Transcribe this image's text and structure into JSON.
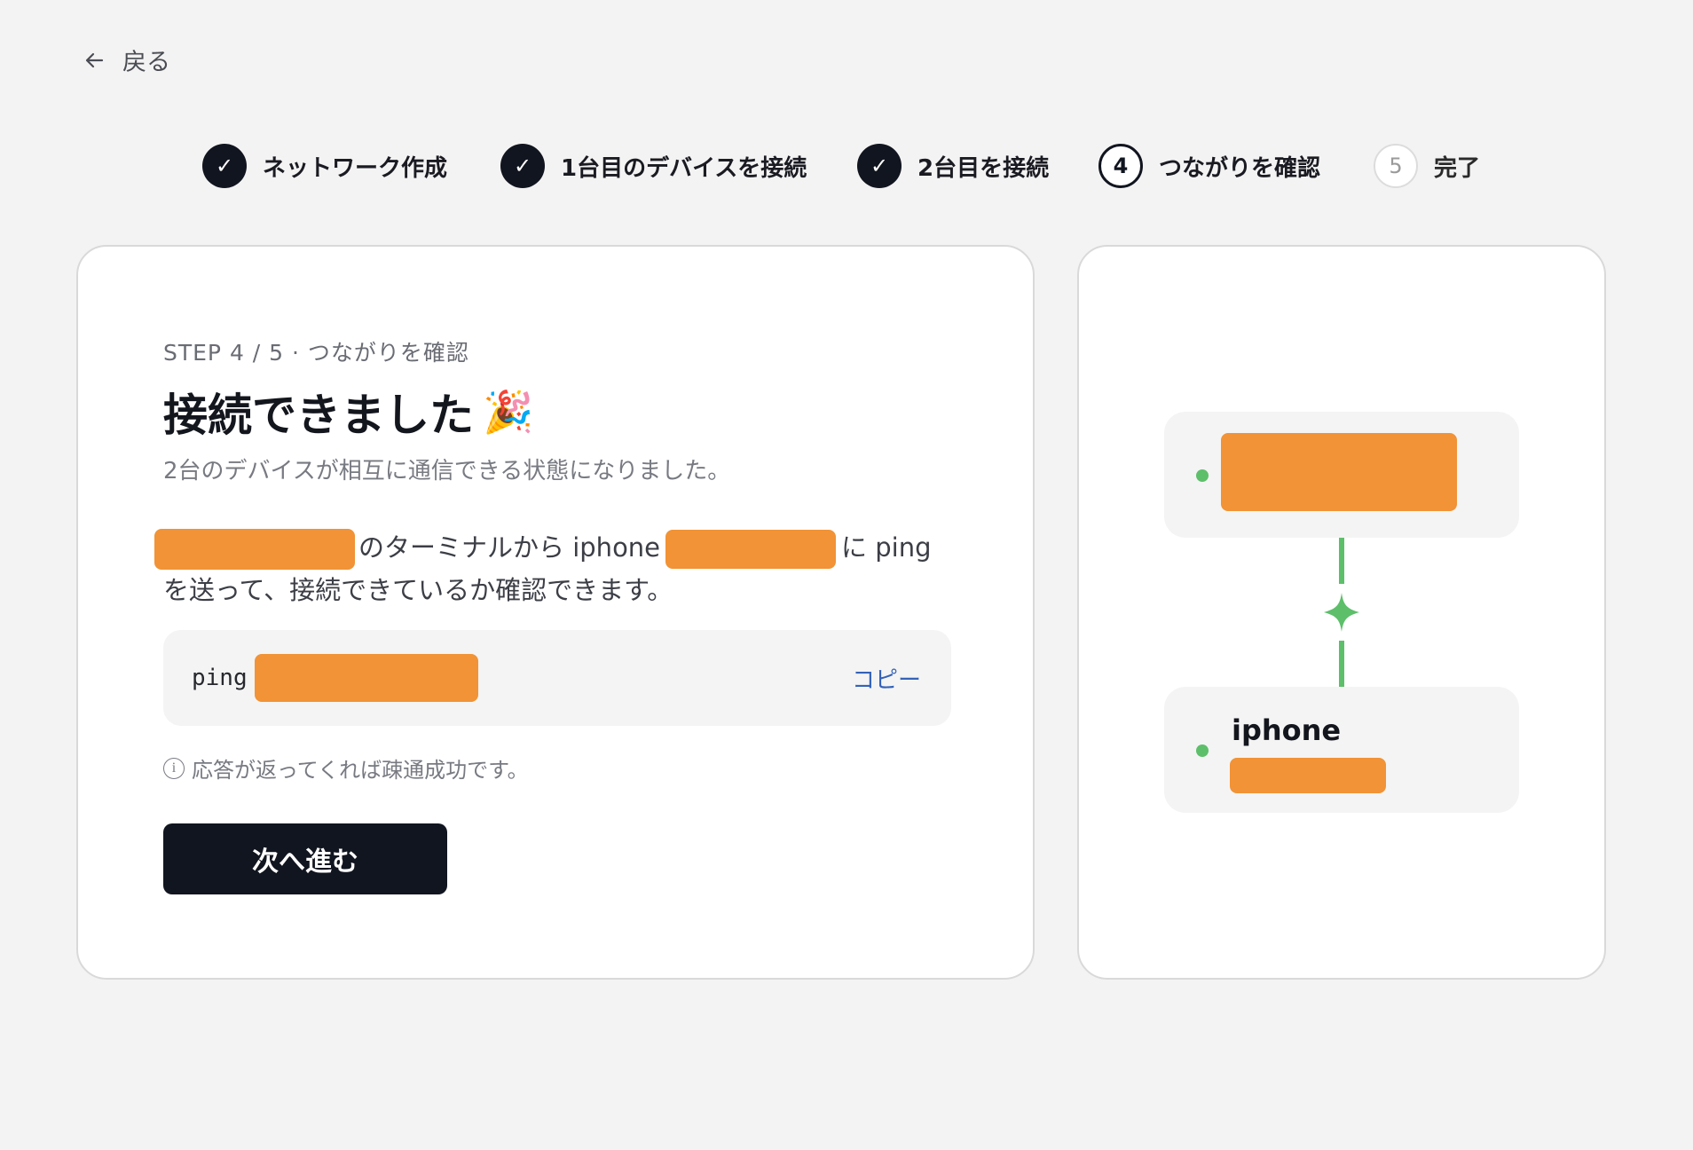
{
  "nav": {
    "back_label": "戻る",
    "back_icon": "arrow-left"
  },
  "stepper": {
    "steps": [
      {
        "label": "ネットワーク作成",
        "marker": "✓",
        "status": "done"
      },
      {
        "label": "1台目のデバイスを接続",
        "marker": "✓",
        "status": "done"
      },
      {
        "label": "2台目を接続",
        "marker": "✓",
        "status": "done"
      },
      {
        "label": "つながりを確認",
        "marker": "4",
        "status": "current"
      },
      {
        "label": "完了",
        "marker": "5",
        "status": "upcoming"
      }
    ]
  },
  "main": {
    "eyebrow": "STEP 4 / 5 · つながりを確認",
    "title": "接続できました",
    "title_emoji": "🎉",
    "subtitle": "2台のデバイスが相互に通信できる状態になりました。",
    "desc_part1": "のターミナルから iphone",
    "desc_part2": "に ping を送って、接続できているか確認できます。",
    "command_prefix": "ping",
    "copy_label": "コピー",
    "hint_icon": "info-icon",
    "hint": "応答が返ってくれば疎通成功です。",
    "next_label": "次へ進む"
  },
  "diagram": {
    "bottom_node_name": "iphone",
    "status_color": "#5dbf6a",
    "link_icon": "sparkle-icon"
  },
  "colors": {
    "redaction": "#f19336",
    "primary": "#11151f",
    "link": "#3462b8",
    "background": "#f4f3f3"
  }
}
